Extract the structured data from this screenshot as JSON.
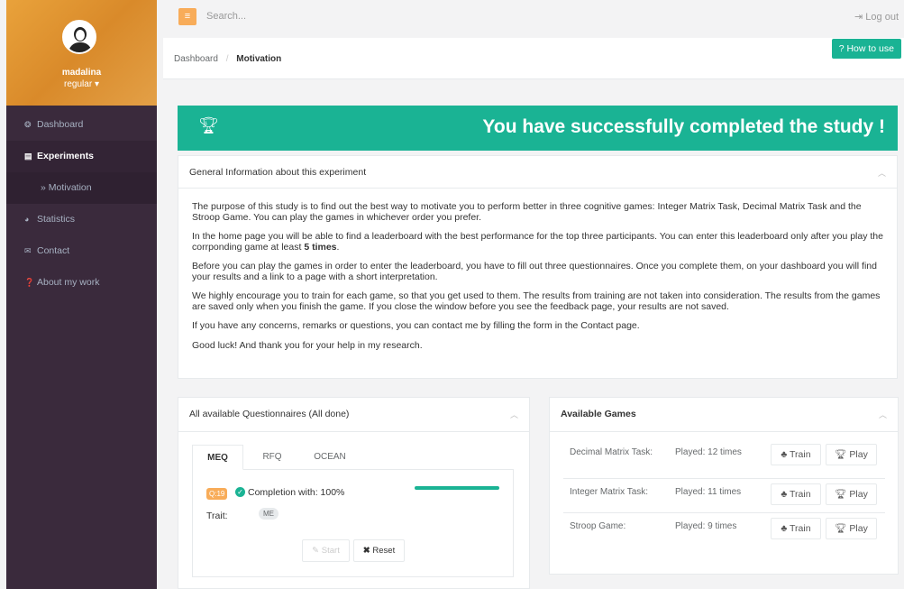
{
  "sidebar": {
    "user_name": "madalina",
    "user_role": "regular ▾",
    "items": [
      {
        "label": "Dashboard",
        "icon": "dashboard-icon",
        "glyph": "❂"
      },
      {
        "label": "Experiments",
        "icon": "experiments-icon",
        "glyph": "▤"
      },
      {
        "label": "» Motivation",
        "icon": "",
        "glyph": ""
      },
      {
        "label": "Statistics",
        "icon": "statistics-icon",
        "glyph": "◕"
      },
      {
        "label": "Contact",
        "icon": "envelope-icon",
        "glyph": "✉"
      },
      {
        "label": "About my work",
        "icon": "question-icon",
        "glyph": "❓"
      }
    ]
  },
  "topbar": {
    "menu_glyph": "≡",
    "search_placeholder": "Search...",
    "logout_label": "Log out"
  },
  "breadcrumb": {
    "home": "Dashboard",
    "separator": "/",
    "current": "Motivation",
    "how_to_use": "? How to use"
  },
  "banner": {
    "message": "You have successfully completed the study !"
  },
  "info_panel": {
    "title": "General Information about this experiment",
    "p1": "The purpose of this study is to find out the best way to motivate you to perform better in three cognitive games: Integer Matrix Task, Decimal Matrix Task and the Stroop Game. You can play the games in whichever order you prefer.",
    "p2a": "In the home page you will be able to find a leaderboard with the best performance for the top three participants. You can enter this leaderboard only after you play the corrponding game at least ",
    "p2b": "5 times",
    "p2c": ".",
    "p3": "Before you can play the games in order to enter the leaderboard, you have to fill out three questionnaires. Once you complete them, on your dashboard you will find your results and a link to a page with a short interpretation.",
    "p4": "We highly encourage you to train for each game, so that you get used to them. The results from training are not taken into consideration. The results from the games are saved only when you finish the game. If you close the window before you see the feedback page, your results are not saved.",
    "p5": "If you have any concerns, remarks or questions, you can contact me by filling the form in the Contact page.",
    "p6": "Good luck! And thank you for your help in my research."
  },
  "questionnaires": {
    "title": "All available Questionnaires (All done)",
    "tabs": [
      "MEQ",
      "RFQ",
      "OCEAN"
    ],
    "badge": "Q:19",
    "completion": "Completion with: 100%",
    "progress": 1.0,
    "trait_label": "Trait:",
    "trait_value": "ME",
    "start_label": "Start",
    "reset_label": "Reset"
  },
  "games": {
    "title": "Available Games",
    "train_label": "Train",
    "play_label": "Play",
    "rows": [
      {
        "name": "Decimal Matrix Task:",
        "played": "Played: 12 times"
      },
      {
        "name": "Integer Matrix Task:",
        "played": "Played: 11 times"
      },
      {
        "name": "Stroop Game:",
        "played": "Played: 9 times"
      }
    ]
  },
  "colors": {
    "accent": "#1ab394",
    "warning": "#f8ac59",
    "sidebar": "#3a2a3c"
  }
}
